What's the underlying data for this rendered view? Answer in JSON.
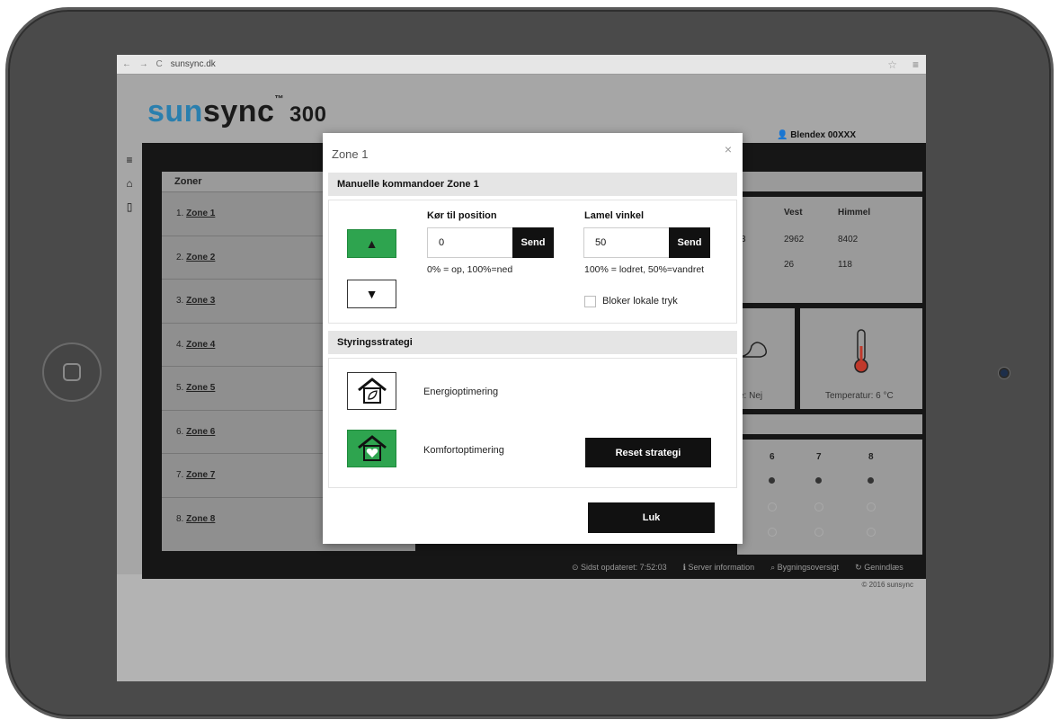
{
  "browser": {
    "url": "sunsync.dk"
  },
  "app": {
    "brand_sun": "sun",
    "brand_rest": "sync",
    "tm": "™",
    "model": "300",
    "user": "Blendex 00XXX"
  },
  "sidebar": {
    "icons": [
      "menu-icon",
      "home-icon",
      "book-icon"
    ]
  },
  "zones": {
    "header": "Zoner",
    "items": [
      {
        "num": "1.",
        "label": "Zone 1"
      },
      {
        "num": "2.",
        "label": "Zone 2"
      },
      {
        "num": "3.",
        "label": "Zone 3"
      },
      {
        "num": "4.",
        "label": "Zone 4"
      },
      {
        "num": "5.",
        "label": "Zone 5"
      },
      {
        "num": "6.",
        "label": "Zone 6"
      },
      {
        "num": "7.",
        "label": "Zone 7"
      },
      {
        "num": "8.",
        "label": "Zone 8"
      }
    ]
  },
  "sensors": {
    "headers": [
      "Vest",
      "Himmel"
    ],
    "row1_prefix": "3",
    "row1": [
      "2962",
      "8402"
    ],
    "row2": [
      "26",
      "118"
    ],
    "rain_suffix": "e: Nej",
    "temperature": "Temperatur: 6 °C",
    "dot_cols": [
      "6",
      "7",
      "8"
    ]
  },
  "footer": {
    "updated": "Sidst opdateret: 7:52:03",
    "server": "Server information",
    "overview": "Bygningsoversigt",
    "reload": "Genindlæs",
    "copyright": "© 2016 sunsync"
  },
  "modal": {
    "title": "Zone 1",
    "close_glyph": "×",
    "manual_header": "Manuelle kommandoer Zone 1",
    "position_label": "Kør til position",
    "position_value": "0",
    "position_send": "Send",
    "position_hint": "0% = op, 100%=ned",
    "angle_label": "Lamel vinkel",
    "angle_value": "50",
    "angle_send": "Send",
    "angle_hint": "100% = lodret, 50%=vandret",
    "block_label": "Bloker lokale tryk",
    "up_glyph": "▲",
    "down_glyph": "▼",
    "strategy_header": "Styringsstrategi",
    "strategy_energy": "Energioptimering",
    "strategy_comfort": "Komfortoptimering",
    "reset_label": "Reset strategi",
    "close_label": "Luk"
  },
  "colors": {
    "accent_green": "#2ea44f",
    "brand_blue": "#2a7fae",
    "button_dark": "#111111"
  }
}
